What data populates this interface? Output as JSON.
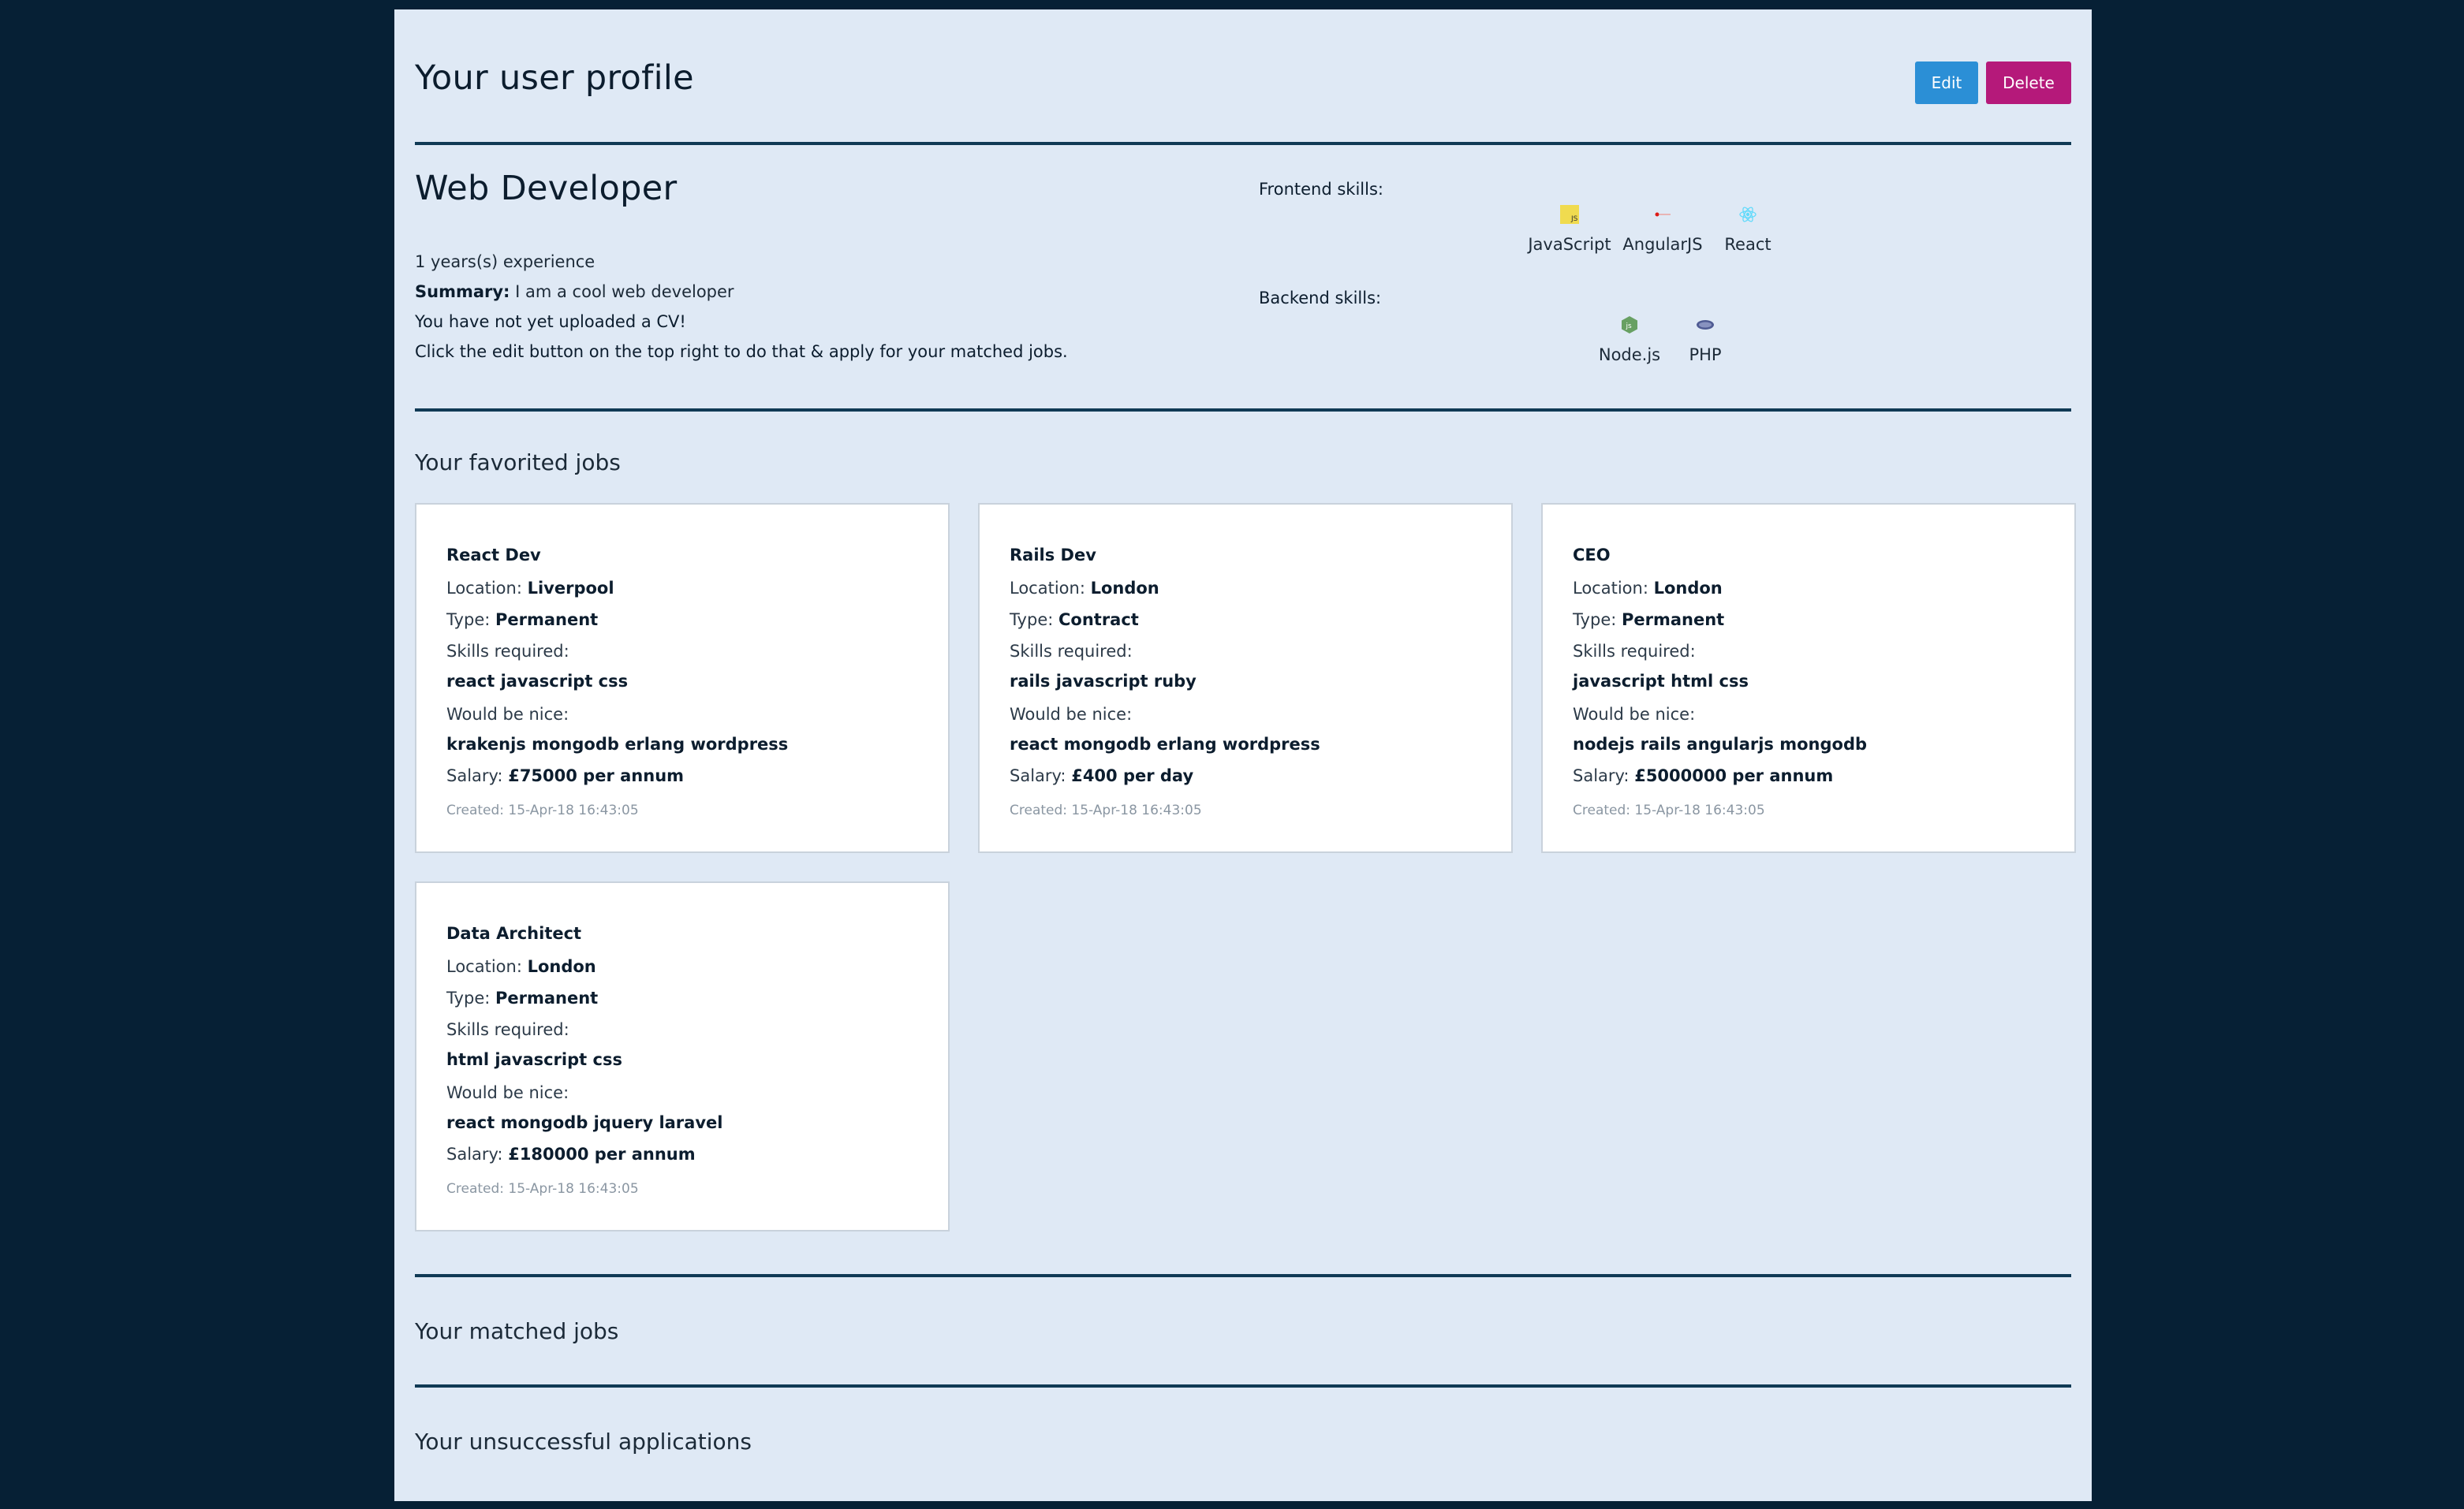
{
  "header": {
    "title": "Your user profile",
    "edit_label": "Edit",
    "delete_label": "Delete"
  },
  "profile": {
    "role": "Web Developer",
    "experience": "1 years(s) experience",
    "summary_label": "Summary:",
    "summary_value": "I am a cool web developer",
    "cv_notice": "You have not yet uploaded a CV!",
    "edit_hint": "Click the edit button on the top right to do that & apply for your matched jobs."
  },
  "skills": {
    "frontend_label": "Frontend skills:",
    "backend_label": "Backend skills:",
    "frontend": [
      {
        "name": "JavaScript",
        "icon": "javascript-icon",
        "color": "#f0db4f"
      },
      {
        "name": "AngularJS",
        "icon": "angularjs-icon",
        "color": "#dd1b16"
      },
      {
        "name": "React",
        "icon": "react-icon",
        "color": "#61dafb"
      }
    ],
    "backend": [
      {
        "name": "Node.js",
        "icon": "nodejs-icon",
        "color": "#68a063"
      },
      {
        "name": "PHP",
        "icon": "php-icon",
        "color": "#4f5b93"
      }
    ]
  },
  "favorited": {
    "title": "Your favorited jobs",
    "labels": {
      "location": "Location:",
      "type": "Type:",
      "skills_required": "Skills required:",
      "would_be_nice": "Would be nice:",
      "salary": "Salary:"
    },
    "jobs": [
      {
        "title": "React Dev",
        "location": "Liverpool",
        "type": "Permanent",
        "skills": "react javascript css",
        "nice": "krakenjs mongodb erlang wordpress",
        "salary": "£75000 per annum",
        "created": "Created: 15-Apr-18 16:43:05"
      },
      {
        "title": "Rails Dev",
        "location": "London",
        "type": "Contract",
        "skills": "rails javascript ruby",
        "nice": "react mongodb erlang wordpress",
        "salary": "£400 per day",
        "created": "Created: 15-Apr-18 16:43:05"
      },
      {
        "title": "CEO",
        "location": "London",
        "type": "Permanent",
        "skills": "javascript html css",
        "nice": "nodejs rails angularjs mongodb",
        "salary": "£5000000 per annum",
        "created": "Created: 15-Apr-18 16:43:05"
      },
      {
        "title": "Data Architect",
        "location": "London",
        "type": "Permanent",
        "skills": "html javascript css",
        "nice": "react mongodb jquery laravel",
        "salary": "£180000 per annum",
        "created": "Created: 15-Apr-18 16:43:05"
      }
    ]
  },
  "matched": {
    "title": "Your matched jobs"
  },
  "unsuccessful": {
    "title": "Your unsuccessful applications"
  },
  "colors": {
    "background": "#062035",
    "page": "#dfe9f5",
    "divider": "#103a55",
    "edit_button": "#2b8fd6",
    "delete_button": "#b5197a"
  }
}
